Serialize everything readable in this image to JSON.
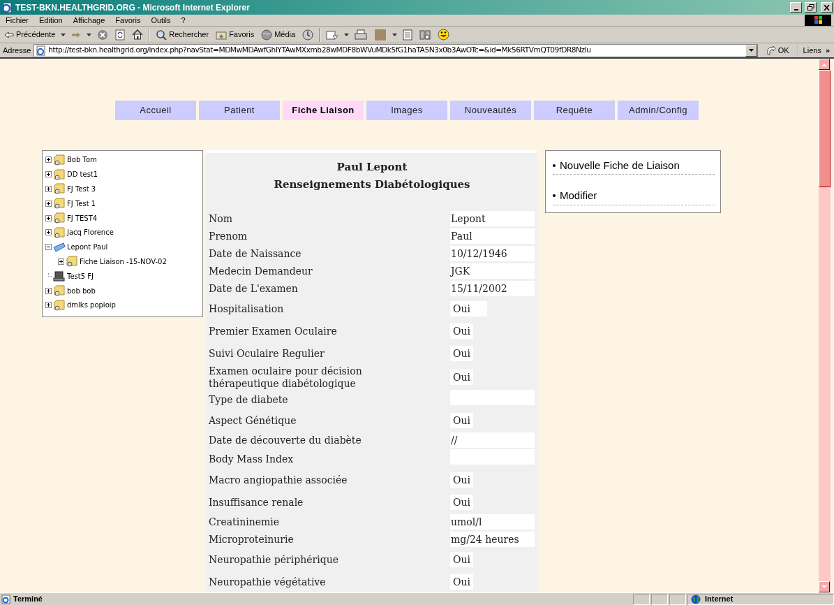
{
  "window": {
    "title": "TEST-BKN.HEALTHGRID.ORG - Microsoft Internet Explorer"
  },
  "menu_bar": [
    "Fichier",
    "Edition",
    "Affichage",
    "Favoris",
    "Outils",
    "?"
  ],
  "toolbar": {
    "back": "Précédente",
    "search": "Rechercher",
    "favorites": "Favoris",
    "media": "Média"
  },
  "address_bar": {
    "label": "Adresse",
    "url": "http://test-bkn.healthgrid.org/index.php?navStat=MDMwMDAwfGhlYTAwMXxmb28wMDF8bWVuMDk5fG1haTA5N3x0b3AwOTc=&id=Mk56RTVmQT09fDR8NzIu",
    "go": "OK",
    "links": "Liens",
    "more": "»"
  },
  "nav_tabs": [
    {
      "label": "Accueil",
      "selected": false
    },
    {
      "label": "Patient",
      "selected": false
    },
    {
      "label": "Fiche Liaison",
      "selected": true
    },
    {
      "label": "Images",
      "selected": false
    },
    {
      "label": "Nouveautés",
      "selected": false
    },
    {
      "label": "Requête",
      "selected": false
    },
    {
      "label": "Admin/Config",
      "selected": false
    }
  ],
  "patient_tree": [
    {
      "label": "Bob Tom",
      "kind": "folder",
      "expanded": false
    },
    {
      "label": "DD test1",
      "kind": "folder",
      "expanded": false
    },
    {
      "label": "FJ Test 3",
      "kind": "folder",
      "expanded": false
    },
    {
      "label": "FJ Test 1",
      "kind": "folder",
      "expanded": false
    },
    {
      "label": "FJ TEST4",
      "kind": "folder",
      "expanded": false
    },
    {
      "label": "Jacq Florence",
      "kind": "folder",
      "expanded": false
    },
    {
      "label": "Lepont Paul",
      "kind": "open",
      "expanded": true,
      "children": [
        {
          "label": "Fiche Liaison -15-NOV-02",
          "kind": "folder",
          "expanded": false
        }
      ]
    },
    {
      "label": "Test5 FJ",
      "kind": "computer"
    },
    {
      "label": "bob bob",
      "kind": "folder",
      "expanded": false
    },
    {
      "label": "dmlks popioip",
      "kind": "folder",
      "expanded": false
    }
  ],
  "record": {
    "title_lines": [
      "Paul Lepont",
      "Renseignements Diabétologiques"
    ],
    "fields": [
      {
        "label": "Nom",
        "value": "Lepont",
        "kind": "text"
      },
      {
        "label": "Prenom",
        "value": "Paul",
        "kind": "text"
      },
      {
        "label": "Date de Naissance",
        "value": "10/12/1946",
        "kind": "text"
      },
      {
        "label": "Medecin Demandeur",
        "value": "JGK",
        "kind": "text"
      },
      {
        "label": "Date de L'examen",
        "value": "15/11/2002",
        "kind": "text"
      },
      {
        "label": "Hospitalisation",
        "value": "Oui",
        "kind": "select"
      },
      {
        "label": "Premier Examen Oculaire",
        "value": "Oui",
        "kind": "choice"
      },
      {
        "label": "Suivi Oculaire Regulier",
        "value": "Oui",
        "kind": "choice"
      },
      {
        "label": "Examen oculaire pour décision thérapeutique diabétologique",
        "value": "Oui",
        "kind": "choice"
      },
      {
        "label": "Type de diabete",
        "kind": "text"
      },
      {
        "label": "Aspect Génétique",
        "value": "Oui",
        "kind": "choice"
      },
      {
        "label": "Date de découverte du diabète",
        "value": "//",
        "kind": "text"
      },
      {
        "label": "Body Mass Index",
        "kind": "text"
      },
      {
        "label": "Macro angiopathie associée",
        "value": "Oui",
        "kind": "choice"
      },
      {
        "label": "Insuffisance renale",
        "value": "Oui",
        "kind": "choice"
      },
      {
        "label": "Creatininemie",
        "value": "umol/l",
        "kind": "text"
      },
      {
        "label": "Microproteinurie",
        "value": "mg/24 heures",
        "kind": "text"
      },
      {
        "label": "Neuropathie périphérique",
        "value": "Oui",
        "kind": "choice"
      },
      {
        "label": "Neuropathie végétative",
        "value": "Oui",
        "kind": "choice"
      }
    ]
  },
  "actions": [
    "Nouvelle Fiche de Liaison",
    "Modifier"
  ],
  "status_bar": {
    "text": "Terminé",
    "zone": "Internet"
  }
}
